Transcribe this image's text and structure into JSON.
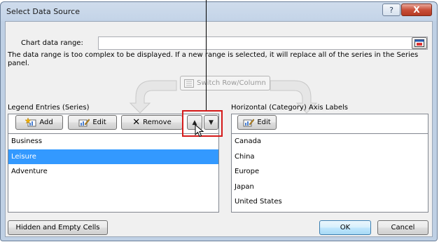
{
  "window": {
    "title": "Select Data Source",
    "help_glyph": "?",
    "close_glyph": "X"
  },
  "chart_data_range": {
    "label": "Chart data range:",
    "value": ""
  },
  "info_text": "The data range is too complex to be displayed. If a new range is selected, it will replace all of the series in the Series panel.",
  "switch_button": {
    "label": "Switch Row/Column",
    "enabled": false
  },
  "legend": {
    "label": "Legend Entries (Series)",
    "add_label": "Add",
    "edit_label": "Edit",
    "remove_label": "Remove",
    "move_up_glyph": "▲",
    "move_down_glyph": "▼",
    "items": [
      {
        "label": "Business",
        "selected": false
      },
      {
        "label": "Leisure",
        "selected": true
      },
      {
        "label": "Adventure",
        "selected": false
      }
    ]
  },
  "axis": {
    "label": "Horizontal (Category) Axis Labels",
    "edit_label": "Edit",
    "items": [
      "Canada",
      "China",
      "Europe",
      "Japan",
      "United States"
    ]
  },
  "footer": {
    "hidden_cells_label": "Hidden and Empty Cells",
    "ok_label": "OK",
    "cancel_label": "Cancel"
  },
  "colors": {
    "selection": "#3399ff",
    "highlight_box": "#d51a1a",
    "title_bar": "#c4d4e8",
    "close_button": "#c9503a"
  },
  "icons": [
    "help-icon",
    "close-icon",
    "collapse-dialog-icon",
    "switch-icon",
    "add-series-icon",
    "edit-icon",
    "remove-x-icon",
    "move-up-icon",
    "move-down-icon",
    "cursor-icon"
  ]
}
